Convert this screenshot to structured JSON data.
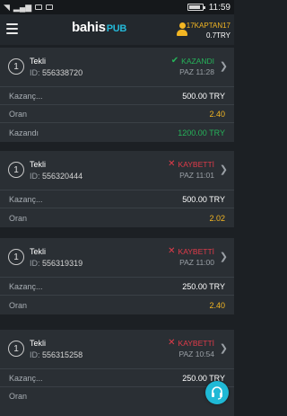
{
  "status_bar": {
    "time": "11:59"
  },
  "header": {
    "logo_main": "bahis",
    "logo_sub": "PUB",
    "username": "17KAPTAN17",
    "balance": "0.7TRY"
  },
  "labels": {
    "stake": "Kazanç...",
    "odds": "Oran",
    "won": "Kazandı",
    "id_prefix": "ID:"
  },
  "bets": [
    {
      "index": "1",
      "type": "Tekli",
      "id": "556338720",
      "status": "KAZANDI",
      "result": "win",
      "date": "PAZ 11:28",
      "stake": "500.00 TRY",
      "odds": "2.40",
      "winnings": "1200.00 TRY"
    },
    {
      "index": "1",
      "type": "Tekli",
      "id": "556320444",
      "status": "KAYBETTİ",
      "result": "lose",
      "date": "PAZ 11:01",
      "stake": "500.00 TRY",
      "odds": "2.02"
    },
    {
      "index": "1",
      "type": "Tekli",
      "id": "556319319",
      "status": "KAYBETTİ",
      "result": "lose",
      "date": "PAZ 11:00",
      "stake": "250.00 TRY",
      "odds": "2.40"
    },
    {
      "index": "1",
      "type": "Tekli",
      "id": "556315258",
      "status": "KAYBETTİ",
      "result": "lose",
      "date": "PAZ 10:54",
      "stake": "250.00 TRY"
    }
  ],
  "icons": {
    "menu": "hamburger-icon",
    "user": "user-icon",
    "win": "check-icon",
    "lose": "x-icon",
    "chevron": "chevron-right-icon",
    "support": "headset-icon"
  },
  "colors": {
    "accent": "#1fb9d6",
    "gold": "#f3b623",
    "win": "#26b35a",
    "lose": "#e23b4a"
  }
}
